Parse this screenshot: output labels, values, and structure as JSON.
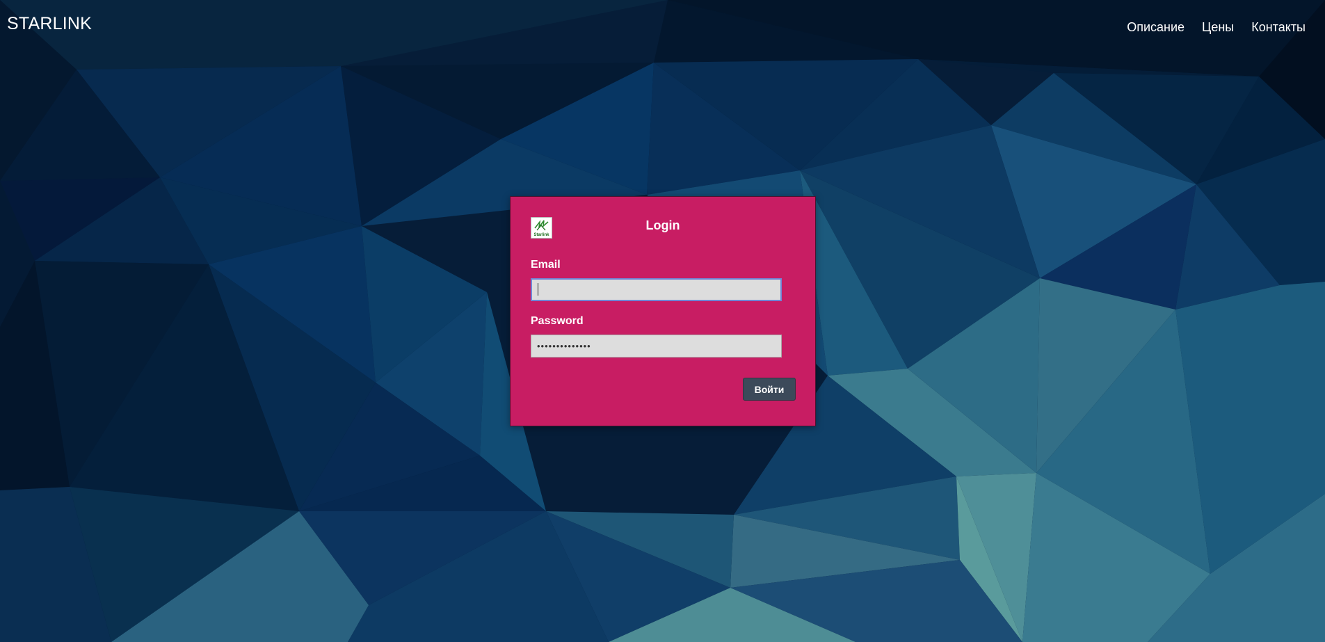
{
  "header": {
    "brand": "STARLINK",
    "nav": [
      {
        "label": "Описание"
      },
      {
        "label": "Цены"
      },
      {
        "label": "Контакты"
      }
    ]
  },
  "login": {
    "title": "Login",
    "logo_text": "Starlink",
    "email_label": "Email",
    "email_value": "",
    "password_label": "Password",
    "password_value": "••••••••••••••",
    "submit_label": "Войти"
  },
  "colors": {
    "card": "#c81d63",
    "button": "#3c4a5a",
    "background": "#07213f"
  }
}
